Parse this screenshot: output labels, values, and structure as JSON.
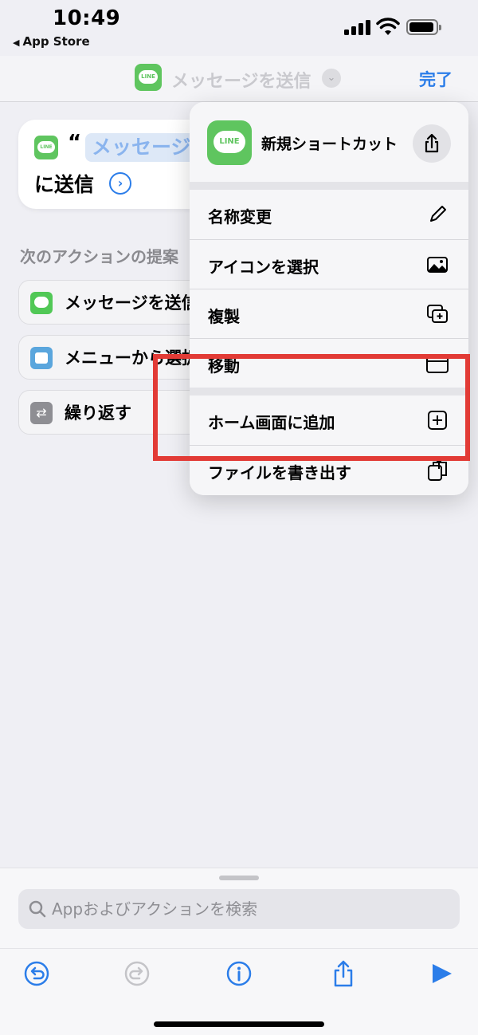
{
  "status_bar": {
    "time": "10:49",
    "back_app": "App Store"
  },
  "nav": {
    "title": "メッセージを送信",
    "done_label": "完了",
    "app_icon_text": "LINE"
  },
  "action_card": {
    "quote": "“",
    "token": "メッセージ",
    "send_text": "に送信"
  },
  "suggestions": {
    "header": "次のアクションの提案",
    "items": [
      {
        "label": "メッセージを送信"
      },
      {
        "label": "メニューから選択"
      },
      {
        "label": "繰り返す"
      }
    ]
  },
  "menu": {
    "title": "新規ショートカット",
    "app_icon_text": "LINE",
    "items": [
      {
        "label": "名称変更",
        "icon": "pencil-icon"
      },
      {
        "label": "アイコンを選択",
        "icon": "photo-icon"
      },
      {
        "label": "複製",
        "icon": "duplicate-icon"
      },
      {
        "label": "移動",
        "icon": "folder-icon"
      },
      {
        "label": "ホーム画面に追加",
        "icon": "plus-square-icon"
      },
      {
        "label": "ファイルを書き出す",
        "icon": "export-icon"
      }
    ]
  },
  "bottom": {
    "search_placeholder": "Appおよびアクションを検索"
  },
  "colors": {
    "accent": "#2b7de9",
    "line_green": "#5fc55f",
    "highlight": "#e23b36",
    "background": "#efeff4"
  }
}
